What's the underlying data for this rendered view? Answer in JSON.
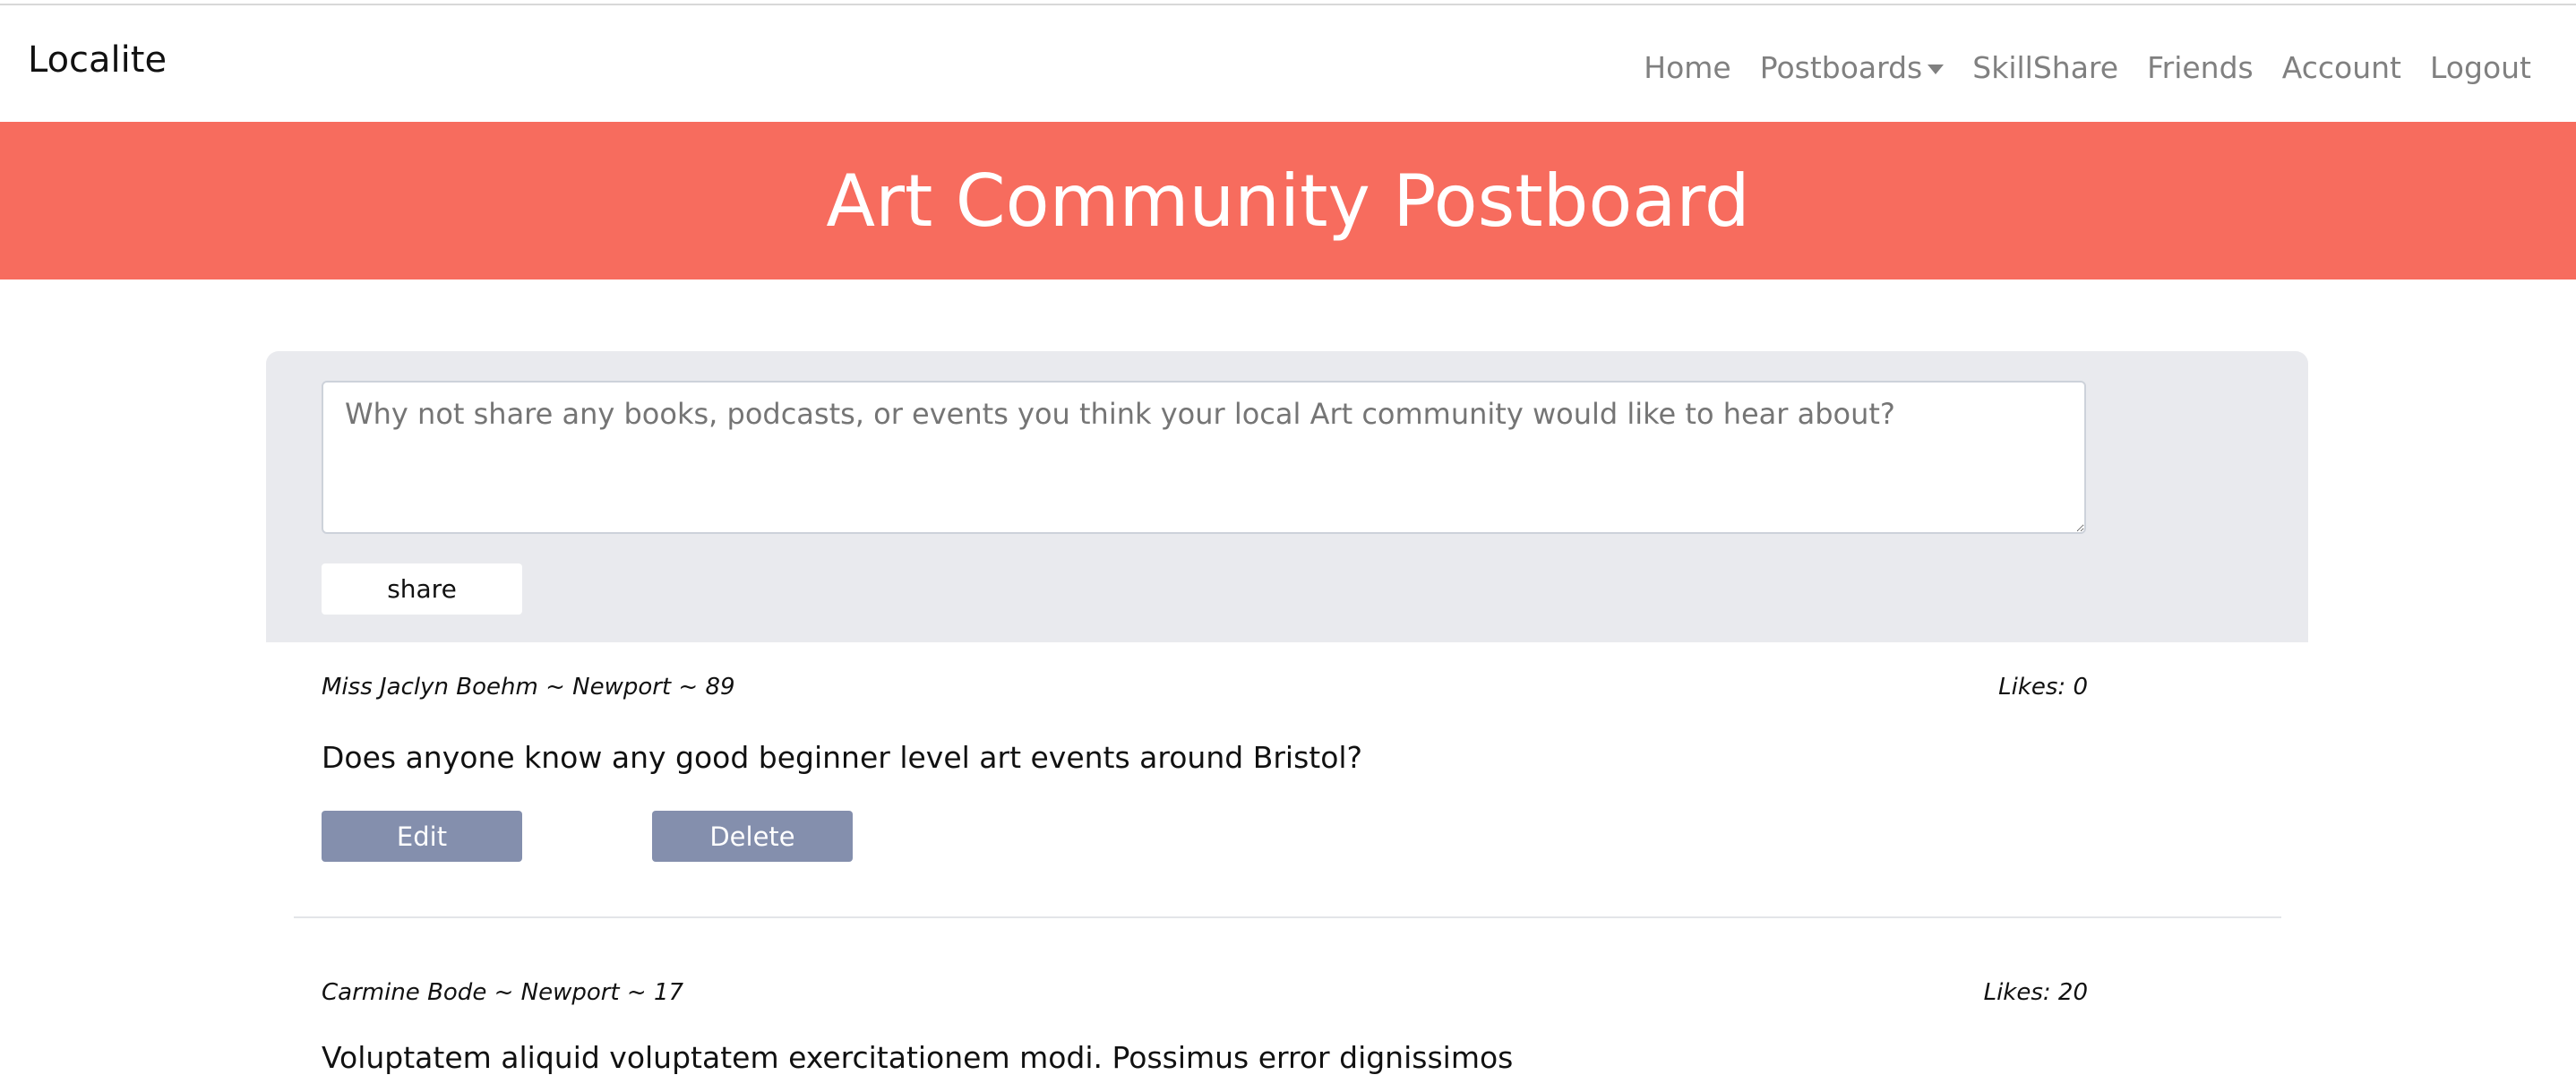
{
  "navbar": {
    "brand": "Localite",
    "links": [
      "Home",
      "Postboards",
      "SkillShare",
      "Friends",
      "Account",
      "Logout"
    ]
  },
  "banner": {
    "title": "Art Community Postboard"
  },
  "composer": {
    "placeholder": "Why not share any books, podcasts, or events you think your local Art community would like to hear about?",
    "share_label": "share"
  },
  "posts": [
    {
      "meta": "Miss Jaclyn Boehm ~ Newport ~ 89",
      "likes": "Likes: 0",
      "content": "Does anyone know any good beginner level art events around Bristol?",
      "edit_label": "Edit",
      "delete_label": "Delete"
    },
    {
      "meta": "Carmine Bode ~ Newport ~ 17",
      "likes": "Likes: 20",
      "content": "Voluptatem aliquid voluptatem exercitationem modi. Possimus error dignissimos"
    }
  ],
  "colors": {
    "banner": "#f76c5e",
    "button": "#848fad",
    "panel": "#e9eaee"
  }
}
